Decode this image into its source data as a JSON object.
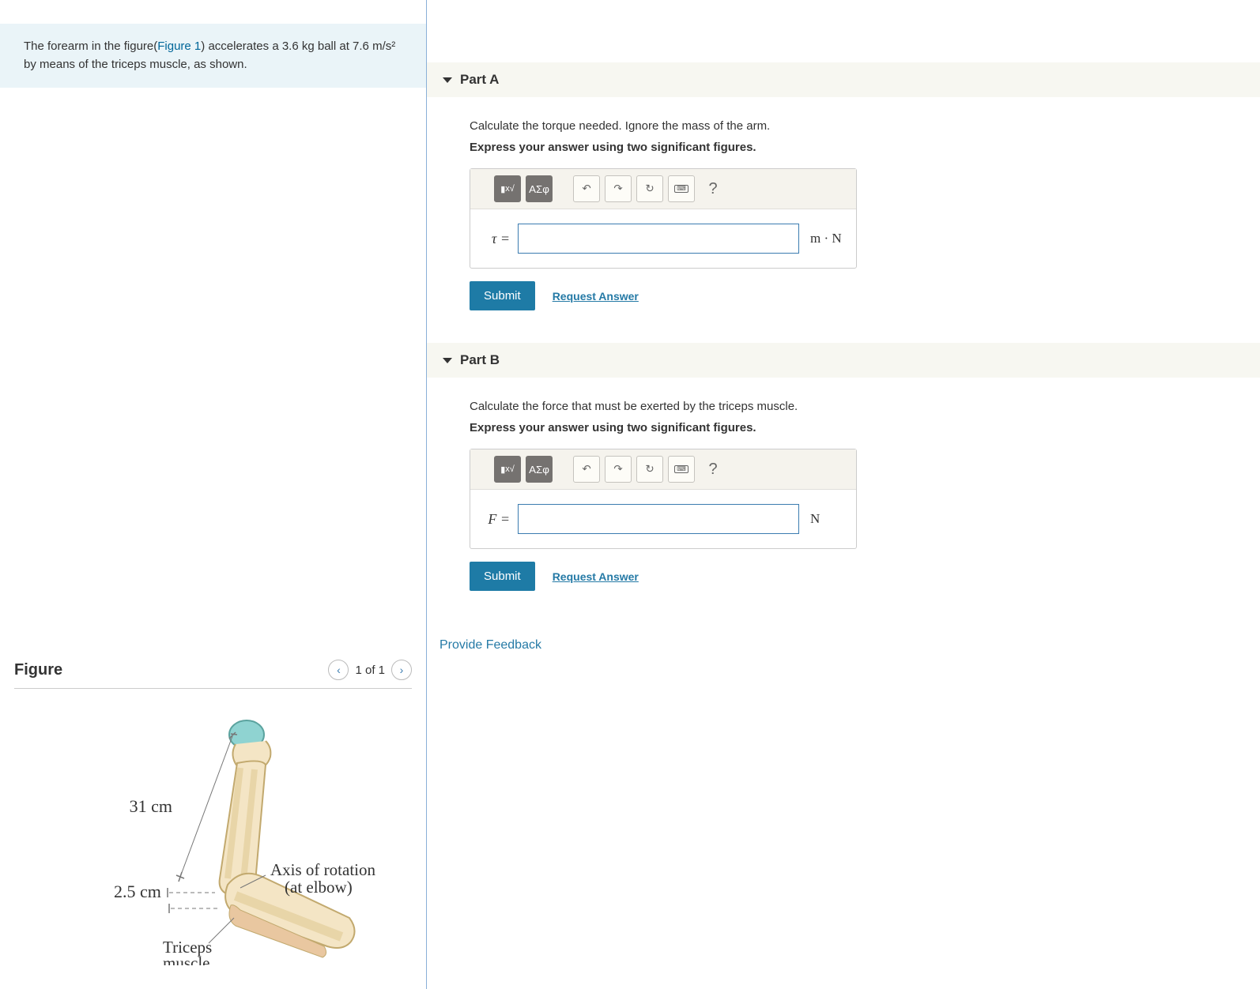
{
  "problem": {
    "prefix": "The forearm in the figure(",
    "figure_link": "Figure 1",
    "text_after_link": ") accelerates a 3.6 kg ball at 7.6 m/s²  by means of the triceps muscle, as shown."
  },
  "figure": {
    "title": "Figure",
    "pager": "1 of 1",
    "labels": {
      "dist1": "31 cm",
      "dist2": "2.5 cm",
      "axis1": "Axis of rotation",
      "axis2": "(at elbow)",
      "muscle1": "Triceps",
      "muscle2": "muscle"
    }
  },
  "parts": [
    {
      "title": "Part A",
      "instruction": "Calculate the torque needed. Ignore the mass of the arm.",
      "bold": "Express your answer using two significant figures.",
      "var": "τ =",
      "units": "m · N"
    },
    {
      "title": "Part B",
      "instruction": "Calculate the force that must be exerted by the triceps muscle.",
      "bold": "Express your answer using two significant figures.",
      "var": "F =",
      "units": "N"
    }
  ],
  "toolbar": {
    "template": "x√",
    "greek": "ΑΣφ",
    "undo": "↶",
    "redo": "↷",
    "reset": "↻",
    "help": "?"
  },
  "buttons": {
    "submit": "Submit",
    "request": "Request Answer"
  },
  "feedback": "Provide Feedback"
}
